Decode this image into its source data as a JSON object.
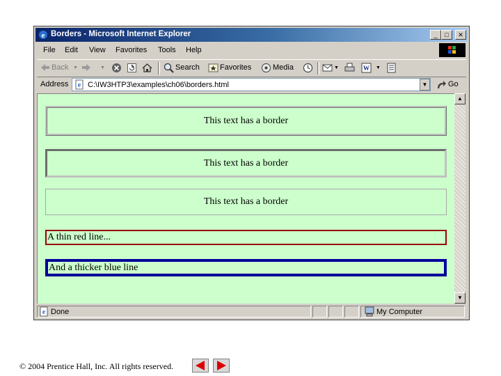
{
  "window": {
    "title": "Borders - Microsoft Internet Explorer",
    "controls": {
      "minimize": "_",
      "maximize": "□",
      "close": "✕"
    }
  },
  "menu": [
    "File",
    "Edit",
    "View",
    "Favorites",
    "Tools",
    "Help"
  ],
  "toolbar": {
    "back": "Back",
    "search": "Search",
    "favorites": "Favorites",
    "media": "Media"
  },
  "address": {
    "label": "Address",
    "url": "C:\\IW3HTP3\\examples\\ch06\\borders.html",
    "go": "Go"
  },
  "content": {
    "boxes": [
      {
        "text": "This text has a border",
        "style": "ridge"
      },
      {
        "text": "This text has a border",
        "style": "inset"
      },
      {
        "text": "This text has a border",
        "style": "solid"
      },
      {
        "text": "A thin red line...",
        "style": "thin-red",
        "color": "#990000"
      },
      {
        "text": "And a thicker blue line",
        "style": "thick-blue",
        "color": "#000099"
      }
    ],
    "background": "#ccffcc"
  },
  "status": {
    "text": "Done",
    "zone": "My Computer"
  },
  "footer": {
    "copyright": "© 2004 Prentice Hall, Inc.  All rights reserved."
  },
  "colors": {
    "nav_arrows": "#dd0000"
  }
}
